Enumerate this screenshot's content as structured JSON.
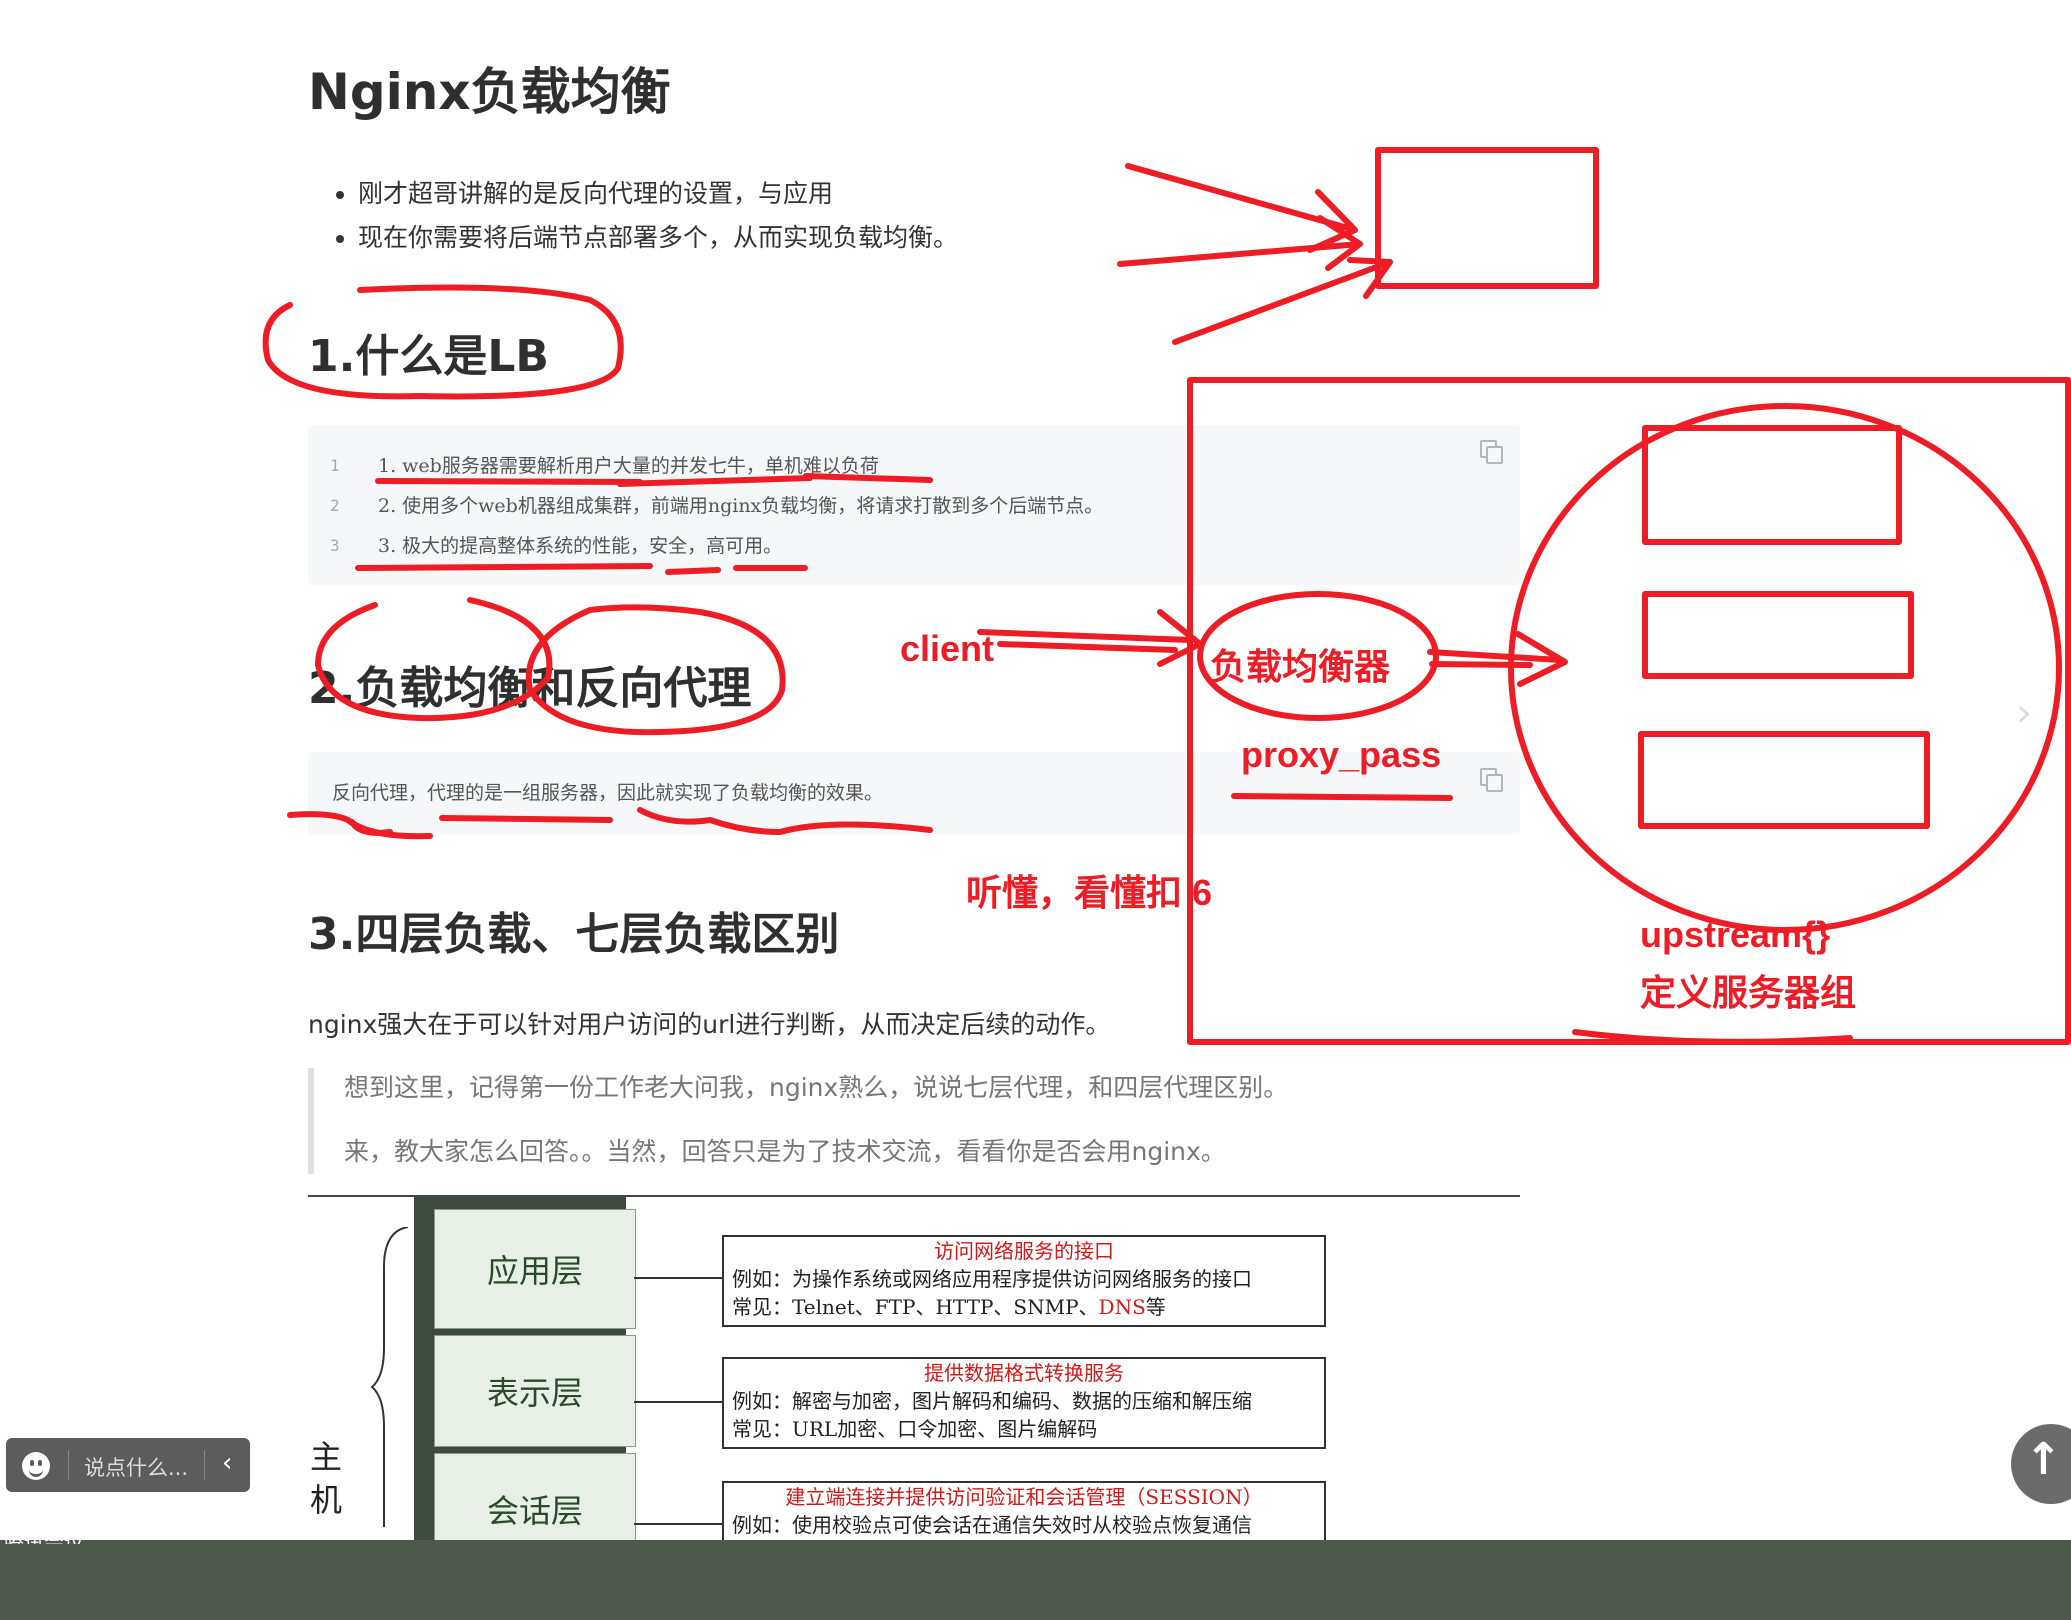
{
  "article": {
    "title": "Nginx负载均衡",
    "bullets": [
      "刚才超哥讲解的是反向代理的设置，与应用",
      "现在你需要将后端节点部署多个，从而实现负载均衡。"
    ],
    "sections": [
      {
        "heading": "1.什么是LB",
        "code": [
          {
            "n": "1",
            "text": "1. web服务器需要解析用户大量的并发七牛，单机难以负荷"
          },
          {
            "n": "2",
            "text": "2. 使用多个web机器组成集群，前端用nginx负载均衡，将请求打散到多个后端节点。"
          },
          {
            "n": "3",
            "text": "3. 极大的提高整体系统的性能，安全，高可用。"
          }
        ]
      },
      {
        "heading": "2.负载均衡和反向代理",
        "code_text": "反向代理，代理的是一组服务器，因此就实现了负载均衡的效果。"
      },
      {
        "heading": "3.四层负载、七层负载区别",
        "paragraph": "nginx强大在于可以针对用户访问的url进行判断，从而决定后续的动作。",
        "quote": [
          "想到这里，记得第一份工作老大问我，nginx熟么，说说七层代理，和四层代理区别。",
          "来，教大家怎么回答。。当然，回答只是为了技术交流，看看你是否会用nginx。"
        ]
      }
    ]
  },
  "osi_diagram": {
    "host_label": "主机",
    "layers": [
      {
        "name": "应用层",
        "title": "访问网络服务的接口",
        "example": "例如：为操作系统或网络应用程序提供访问网络服务的接口",
        "common": "常见：Telnet、FTP、HTTP、SNMP、",
        "common_red": "DNS",
        "common_tail": "等"
      },
      {
        "name": "表示层",
        "title": "提供数据格式转换服务",
        "example": "例如：解密与加密，图片解码和编码、数据的压缩和解压缩",
        "common": "常见：URL加密、口令加密、图片编解码"
      },
      {
        "name": "会话层",
        "title": "建立端连接并提供访问验证和会话管理（SESSION）",
        "example": "例如：使用校验点可使会话在通信失效时从校验点恢复通信"
      }
    ]
  },
  "annotations": {
    "client": "client",
    "load_balancer": "负载均衡器",
    "proxy_pass": "proxy_pass",
    "understand": "听懂，看懂扣 6",
    "upstream": "upstream{}",
    "server_group": "定义服务器组",
    "color": "#ee1c24"
  },
  "chat_widget": {
    "placeholder": "说点什么...",
    "collapse_arrow": "‹"
  },
  "scroll_top_icon": "↑",
  "next_icon": "›",
  "bottom_bar_label": "腾讯会议",
  "colors": {
    "code_bg": "#f6f7f8",
    "bottom_bar": "#4f584d",
    "annotation_red": "#ee1c24",
    "layer_fill": "#e7efe6"
  }
}
